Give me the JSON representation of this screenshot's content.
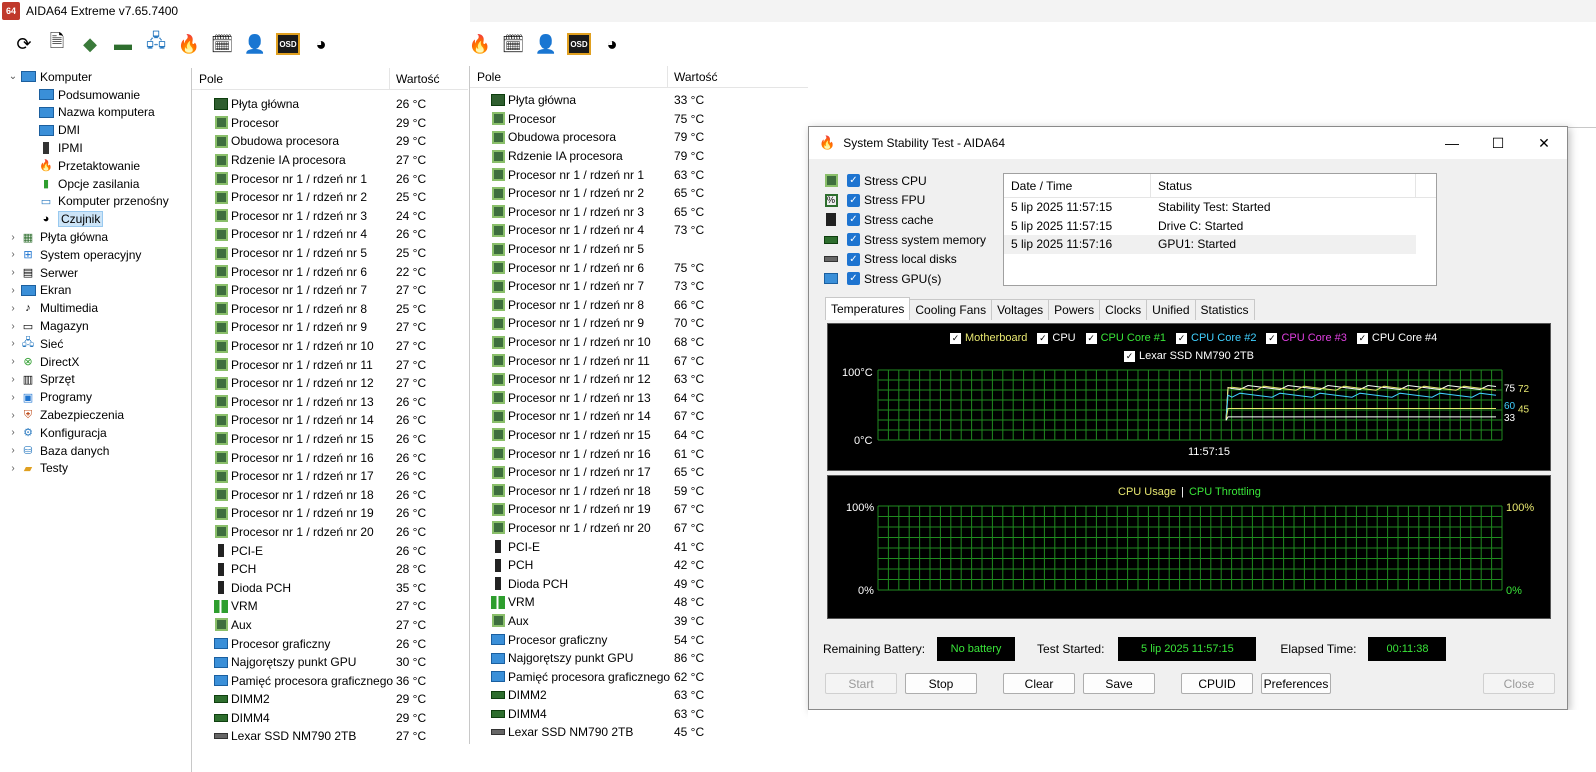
{
  "app": {
    "logo": "64",
    "title": "AIDA64 Extreme v7.65.7400"
  },
  "tree": {
    "items": [
      {
        "label": "Komputer",
        "level": 0,
        "expanded": true,
        "icon": "computer-icon"
      },
      {
        "label": "Podsumowanie",
        "level": 1,
        "icon": "monitor-icon"
      },
      {
        "label": "Nazwa komputera",
        "level": 1,
        "icon": "monitor-icon"
      },
      {
        "label": "DMI",
        "level": 1,
        "icon": "monitor-icon"
      },
      {
        "label": "IPMI",
        "level": 1,
        "icon": "phone-icon"
      },
      {
        "label": "Przetaktowanie",
        "level": 1,
        "icon": "flame-icon"
      },
      {
        "label": "Opcje zasilania",
        "level": 1,
        "icon": "power-icon"
      },
      {
        "label": "Komputer przenośny",
        "level": 1,
        "icon": "laptop-icon"
      },
      {
        "label": "Czujnik",
        "level": 1,
        "icon": "gauge-icon",
        "selected": true
      },
      {
        "label": "Płyta główna",
        "level": 0,
        "icon": "motherboard-icon"
      },
      {
        "label": "System operacyjny",
        "level": 0,
        "icon": "windows-icon"
      },
      {
        "label": "Serwer",
        "level": 0,
        "icon": "server-icon"
      },
      {
        "label": "Ekran",
        "level": 0,
        "icon": "monitor-icon"
      },
      {
        "label": "Multimedia",
        "level": 0,
        "icon": "speaker-icon"
      },
      {
        "label": "Magazyn",
        "level": 0,
        "icon": "storage-icon"
      },
      {
        "label": "Sieć",
        "level": 0,
        "icon": "network-icon"
      },
      {
        "label": "DirectX",
        "level": 0,
        "icon": "xbox-icon"
      },
      {
        "label": "Sprzęt",
        "level": 0,
        "icon": "hardware-icon"
      },
      {
        "label": "Programy",
        "level": 0,
        "icon": "programs-icon"
      },
      {
        "label": "Zabezpieczenia",
        "level": 0,
        "icon": "shield-icon"
      },
      {
        "label": "Konfiguracja",
        "level": 0,
        "icon": "config-icon"
      },
      {
        "label": "Baza danych",
        "level": 0,
        "icon": "database-icon"
      },
      {
        "label": "Testy",
        "level": 0,
        "icon": "benchmark-icon"
      }
    ]
  },
  "left_panel": {
    "col_field": "Pole",
    "col_value": "Wartość",
    "rows": [
      {
        "field": "Płyta główna",
        "value": "26 °C",
        "icon": "board"
      },
      {
        "field": "Procesor",
        "value": "29 °C",
        "icon": "chip"
      },
      {
        "field": "Obudowa procesora",
        "value": "29 °C",
        "icon": "chip"
      },
      {
        "field": "Rdzenie IA procesora",
        "value": "27 °C",
        "icon": "chip"
      },
      {
        "field": "Procesor nr 1 / rdzeń nr 1",
        "value": "26 °C",
        "icon": "chip"
      },
      {
        "field": "Procesor nr 1 / rdzeń nr 2",
        "value": "25 °C",
        "icon": "chip"
      },
      {
        "field": "Procesor nr 1 / rdzeń nr 3",
        "value": "24 °C",
        "icon": "chip"
      },
      {
        "field": "Procesor nr 1 / rdzeń nr 4",
        "value": "26 °C",
        "icon": "chip"
      },
      {
        "field": "Procesor nr 1 / rdzeń nr 5",
        "value": "25 °C",
        "icon": "chip"
      },
      {
        "field": "Procesor nr 1 / rdzeń nr 6",
        "value": "22 °C",
        "icon": "chip"
      },
      {
        "field": "Procesor nr 1 / rdzeń nr 7",
        "value": "27 °C",
        "icon": "chip"
      },
      {
        "field": "Procesor nr 1 / rdzeń nr 8",
        "value": "25 °C",
        "icon": "chip"
      },
      {
        "field": "Procesor nr 1 / rdzeń nr 9",
        "value": "27 °C",
        "icon": "chip"
      },
      {
        "field": "Procesor nr 1 / rdzeń nr 10",
        "value": "27 °C",
        "icon": "chip"
      },
      {
        "field": "Procesor nr 1 / rdzeń nr 11",
        "value": "27 °C",
        "icon": "chip"
      },
      {
        "field": "Procesor nr 1 / rdzeń nr 12",
        "value": "27 °C",
        "icon": "chip"
      },
      {
        "field": "Procesor nr 1 / rdzeń nr 13",
        "value": "26 °C",
        "icon": "chip"
      },
      {
        "field": "Procesor nr 1 / rdzeń nr 14",
        "value": "26 °C",
        "icon": "chip"
      },
      {
        "field": "Procesor nr 1 / rdzeń nr 15",
        "value": "26 °C",
        "icon": "chip"
      },
      {
        "field": "Procesor nr 1 / rdzeń nr 16",
        "value": "26 °C",
        "icon": "chip"
      },
      {
        "field": "Procesor nr 1 / rdzeń nr 17",
        "value": "26 °C",
        "icon": "chip"
      },
      {
        "field": "Procesor nr 1 / rdzeń nr 18",
        "value": "26 °C",
        "icon": "chip"
      },
      {
        "field": "Procesor nr 1 / rdzeń nr 19",
        "value": "26 °C",
        "icon": "chip"
      },
      {
        "field": "Procesor nr 1 / rdzeń nr 20",
        "value": "26 °C",
        "icon": "chip"
      },
      {
        "field": "PCI-E",
        "value": "26 °C",
        "icon": "bar"
      },
      {
        "field": "PCH",
        "value": "28 °C",
        "icon": "bar"
      },
      {
        "field": "Dioda PCH",
        "value": "35 °C",
        "icon": "bar"
      },
      {
        "field": "VRM",
        "value": "27 °C",
        "icon": "vrm"
      },
      {
        "field": "Aux",
        "value": "27 °C",
        "icon": "chip"
      },
      {
        "field": "Procesor graficzny",
        "value": "26 °C",
        "icon": "gpu"
      },
      {
        "field": "Najgorętszy punkt GPU",
        "value": "30 °C",
        "icon": "gpu"
      },
      {
        "field": "Pamięć procesora graficznego",
        "value": "36 °C",
        "icon": "gpu"
      },
      {
        "field": "DIMM2",
        "value": "29 °C",
        "icon": "dimm"
      },
      {
        "field": "DIMM4",
        "value": "29 °C",
        "icon": "dimm"
      },
      {
        "field": "Lexar SSD NM790 2TB",
        "value": "27 °C",
        "icon": "ssd"
      }
    ]
  },
  "right_panel": {
    "col_field": "Pole",
    "col_value": "Wartość",
    "rows": [
      {
        "field": "Płyta główna",
        "value": "33 °C",
        "icon": "board"
      },
      {
        "field": "Procesor",
        "value": "75 °C",
        "icon": "chip"
      },
      {
        "field": "Obudowa procesora",
        "value": "79 °C",
        "icon": "chip"
      },
      {
        "field": "Rdzenie IA procesora",
        "value": "79 °C",
        "icon": "chip"
      },
      {
        "field": "Procesor nr 1 / rdzeń nr 1",
        "value": "63 °C",
        "icon": "chip"
      },
      {
        "field": "Procesor nr 1 / rdzeń nr 2",
        "value": "65 °C",
        "icon": "chip"
      },
      {
        "field": "Procesor nr 1 / rdzeń nr 3",
        "value": "65 °C",
        "icon": "chip"
      },
      {
        "field": "Procesor nr 1 / rdzeń nr 4",
        "value": "73 °C",
        "icon": "chip"
      },
      {
        "field": "Procesor nr 1 / rdzeń nr 5",
        "value": "",
        "icon": "chip"
      },
      {
        "field": "Procesor nr 1 / rdzeń nr 6",
        "value": "75 °C",
        "icon": "chip"
      },
      {
        "field": "Procesor nr 1 / rdzeń nr 7",
        "value": "73 °C",
        "icon": "chip"
      },
      {
        "field": "Procesor nr 1 / rdzeń nr 8",
        "value": "66 °C",
        "icon": "chip"
      },
      {
        "field": "Procesor nr 1 / rdzeń nr 9",
        "value": "70 °C",
        "icon": "chip"
      },
      {
        "field": "Procesor nr 1 / rdzeń nr 10",
        "value": "68 °C",
        "icon": "chip"
      },
      {
        "field": "Procesor nr 1 / rdzeń nr 11",
        "value": "67 °C",
        "icon": "chip"
      },
      {
        "field": "Procesor nr 1 / rdzeń nr 12",
        "value": "63 °C",
        "icon": "chip"
      },
      {
        "field": "Procesor nr 1 / rdzeń nr 13",
        "value": "64 °C",
        "icon": "chip"
      },
      {
        "field": "Procesor nr 1 / rdzeń nr 14",
        "value": "67 °C",
        "icon": "chip"
      },
      {
        "field": "Procesor nr 1 / rdzeń nr 15",
        "value": "64 °C",
        "icon": "chip"
      },
      {
        "field": "Procesor nr 1 / rdzeń nr 16",
        "value": "61 °C",
        "icon": "chip"
      },
      {
        "field": "Procesor nr 1 / rdzeń nr 17",
        "value": "65 °C",
        "icon": "chip"
      },
      {
        "field": "Procesor nr 1 / rdzeń nr 18",
        "value": "59 °C",
        "icon": "chip"
      },
      {
        "field": "Procesor nr 1 / rdzeń nr 19",
        "value": "67 °C",
        "icon": "chip"
      },
      {
        "field": "Procesor nr 1 / rdzeń nr 20",
        "value": "67 °C",
        "icon": "chip"
      },
      {
        "field": "PCI-E",
        "value": "41 °C",
        "icon": "bar"
      },
      {
        "field": "PCH",
        "value": "42 °C",
        "icon": "bar"
      },
      {
        "field": "Dioda PCH",
        "value": "49 °C",
        "icon": "bar"
      },
      {
        "field": "VRM",
        "value": "48 °C",
        "icon": "vrm"
      },
      {
        "field": "Aux",
        "value": "39 °C",
        "icon": "chip"
      },
      {
        "field": "Procesor graficzny",
        "value": "54 °C",
        "icon": "gpu"
      },
      {
        "field": "Najgorętszy punkt GPU",
        "value": "86 °C",
        "icon": "gpu"
      },
      {
        "field": "Pamięć procesora graficznego",
        "value": "62 °C",
        "icon": "gpu"
      },
      {
        "field": "DIMM2",
        "value": "63 °C",
        "icon": "dimm"
      },
      {
        "field": "DIMM4",
        "value": "63 °C",
        "icon": "dimm"
      },
      {
        "field": "Lexar SSD NM790 2TB",
        "value": "45 °C",
        "icon": "ssd"
      }
    ]
  },
  "sst": {
    "title": "System Stability Test - AIDA64",
    "stress": [
      {
        "label": "Stress CPU",
        "checked": true,
        "icon": "cpu-stress-icon"
      },
      {
        "label": "Stress FPU",
        "checked": true,
        "icon": "fpu-stress-icon"
      },
      {
        "label": "Stress cache",
        "checked": true,
        "icon": "cache-stress-icon"
      },
      {
        "label": "Stress system memory",
        "checked": true,
        "icon": "memory-stress-icon"
      },
      {
        "label": "Stress local disks",
        "checked": true,
        "icon": "disk-stress-icon"
      },
      {
        "label": "Stress GPU(s)",
        "checked": true,
        "icon": "gpu-stress-icon"
      }
    ],
    "log": {
      "col_date": "Date / Time",
      "col_status": "Status",
      "rows": [
        {
          "date": "5 lip 2025 11:57:15",
          "status": "Stability Test: Started"
        },
        {
          "date": "5 lip 2025 11:57:15",
          "status": "Drive C: Started"
        },
        {
          "date": "5 lip 2025 11:57:16",
          "status": "GPU1: Started"
        }
      ]
    },
    "tabs": [
      "Temperatures",
      "Cooling Fans",
      "Voltages",
      "Powers",
      "Clocks",
      "Unified",
      "Statistics"
    ],
    "temp_legend": [
      {
        "label": "Motherboard",
        "color": "#e8e870"
      },
      {
        "label": "CPU",
        "color": "#ffffff"
      },
      {
        "label": "CPU Core #1",
        "color": "#39e539"
      },
      {
        "label": "CPU Core #2",
        "color": "#40d0ff"
      },
      {
        "label": "CPU Core #3",
        "color": "#e040e0"
      },
      {
        "label": "CPU Core #4",
        "color": "#ffffff"
      },
      {
        "label": "Lexar SSD NM790 2TB",
        "color": "#ffffff"
      }
    ],
    "temp_graph": {
      "y_top": "100°C",
      "y_bottom": "0°C",
      "x_label": "11:57:15",
      "right_labels": [
        {
          "text": "75",
          "color": "#ffffff",
          "value": 75
        },
        {
          "text": "72",
          "color": "#e8e870",
          "value": 74
        },
        {
          "text": "60",
          "color": "#40d0ff",
          "value": 64
        },
        {
          "text": "45",
          "color": "#e8e870",
          "value": 45
        },
        {
          "text": "33",
          "color": "#ffffff",
          "value": 33
        }
      ]
    },
    "usage_graph": {
      "legend_usage": "CPU Usage",
      "legend_sep": "|",
      "legend_throttle": "CPU Throttling",
      "y_top": "100%",
      "y_bottom": "0%",
      "right_top": "100%",
      "right_bottom": "0%"
    },
    "status": {
      "battery_label": "Remaining Battery:",
      "battery_value": "No battery",
      "started_label": "Test Started:",
      "started_value": "5 lip 2025 11:57:15",
      "elapsed_label": "Elapsed Time:",
      "elapsed_value": "00:11:38"
    },
    "buttons": {
      "start": "Start",
      "stop": "Stop",
      "clear": "Clear",
      "save": "Save",
      "cpuid": "CPUID",
      "preferences": "Preferences",
      "close": "Close"
    },
    "colors": {
      "grid": "#1f8a1f",
      "led_text": "#39e539",
      "usage_legend": "#e8e870",
      "throttle_legend": "#39e539"
    }
  }
}
